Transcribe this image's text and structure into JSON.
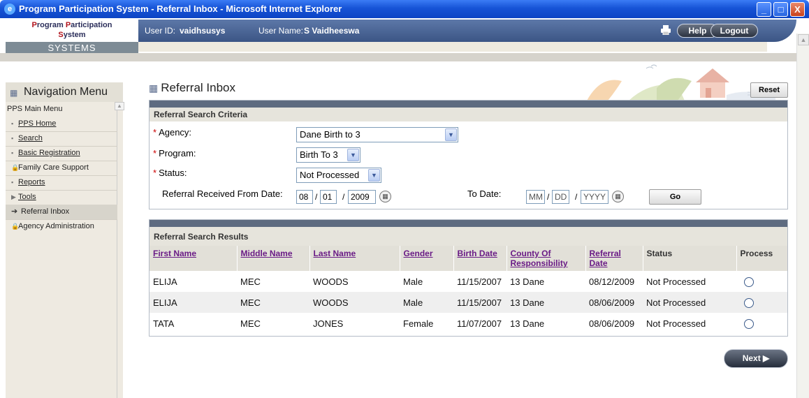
{
  "window": {
    "title": "Program Participation System - Referral Inbox - Microsoft Internet Explorer",
    "min_glyph": "_",
    "max_glyph": "□",
    "close_glyph": "X"
  },
  "header": {
    "logo_line1_a": "P",
    "logo_line1_b": "rogram ",
    "logo_line1_c": "P",
    "logo_line1_d": "articipation",
    "logo_line2_a": "S",
    "logo_line2_b": "ystem",
    "logo_bottom": "SYSTEMS",
    "user_id_label": "User ID:",
    "user_id": "vaidhsusys",
    "user_name_label": "User Name:",
    "user_name": "S Vaidheeswa",
    "help_label": "Help",
    "logout_label": "Logout"
  },
  "nav": {
    "title": "Navigation Menu",
    "items": [
      {
        "label": "PPS Main Menu"
      },
      {
        "label": "PPS Home"
      },
      {
        "label": "Search"
      },
      {
        "label": "Basic Registration"
      },
      {
        "label": "Family Care Support"
      },
      {
        "label": "Reports"
      },
      {
        "label": "Tools"
      },
      {
        "label": "Referral Inbox"
      },
      {
        "label": "Agency Administration"
      }
    ]
  },
  "main": {
    "title": "Referral Inbox",
    "reset_label": "Reset",
    "criteria": {
      "heading": "Referral Search Criteria",
      "agency_label": "Agency:",
      "agency_value": "Dane Birth to 3",
      "program_label": "Program:",
      "program_value": "Birth To 3",
      "status_label": "Status:",
      "status_value": "Not Processed",
      "from_label": "Referral Received From Date:",
      "from_mm": "08",
      "from_dd": "01",
      "from_yyyy": "2009",
      "to_label": "To Date:",
      "to_mm": "MM",
      "to_dd": "DD",
      "to_yyyy": "YYYY",
      "go_label": "Go"
    },
    "results": {
      "heading": "Referral Search Results",
      "columns": [
        "First Name",
        "Middle Name",
        "Last Name",
        "Gender",
        "Birth Date",
        "County Of",
        "Responsibility",
        "Referral",
        "Date",
        "Status",
        "Process"
      ],
      "rows": [
        [
          "ELIJA",
          "MEC",
          "WOODS",
          "Male",
          "11/15/2007",
          "13 Dane",
          "08/12/2009",
          "Not Processed"
        ],
        [
          "ELIJA",
          "MEC",
          "WOODS",
          "Male",
          "11/15/2007",
          "13 Dane",
          "08/06/2009",
          "Not Processed"
        ],
        [
          "TATA",
          "MEC",
          "JONES",
          "Female",
          "11/07/2007",
          "13 Dane",
          "08/06/2009",
          "Not Processed"
        ]
      ]
    },
    "next_label": "Next ▶"
  },
  "icons": [
    "ie-icon",
    "printer-icon",
    "grid-icon",
    "calendar-icon",
    "dropdown-arrow-icon",
    "arrow-right-icon",
    "lock-icon",
    "bullet-icon"
  ]
}
